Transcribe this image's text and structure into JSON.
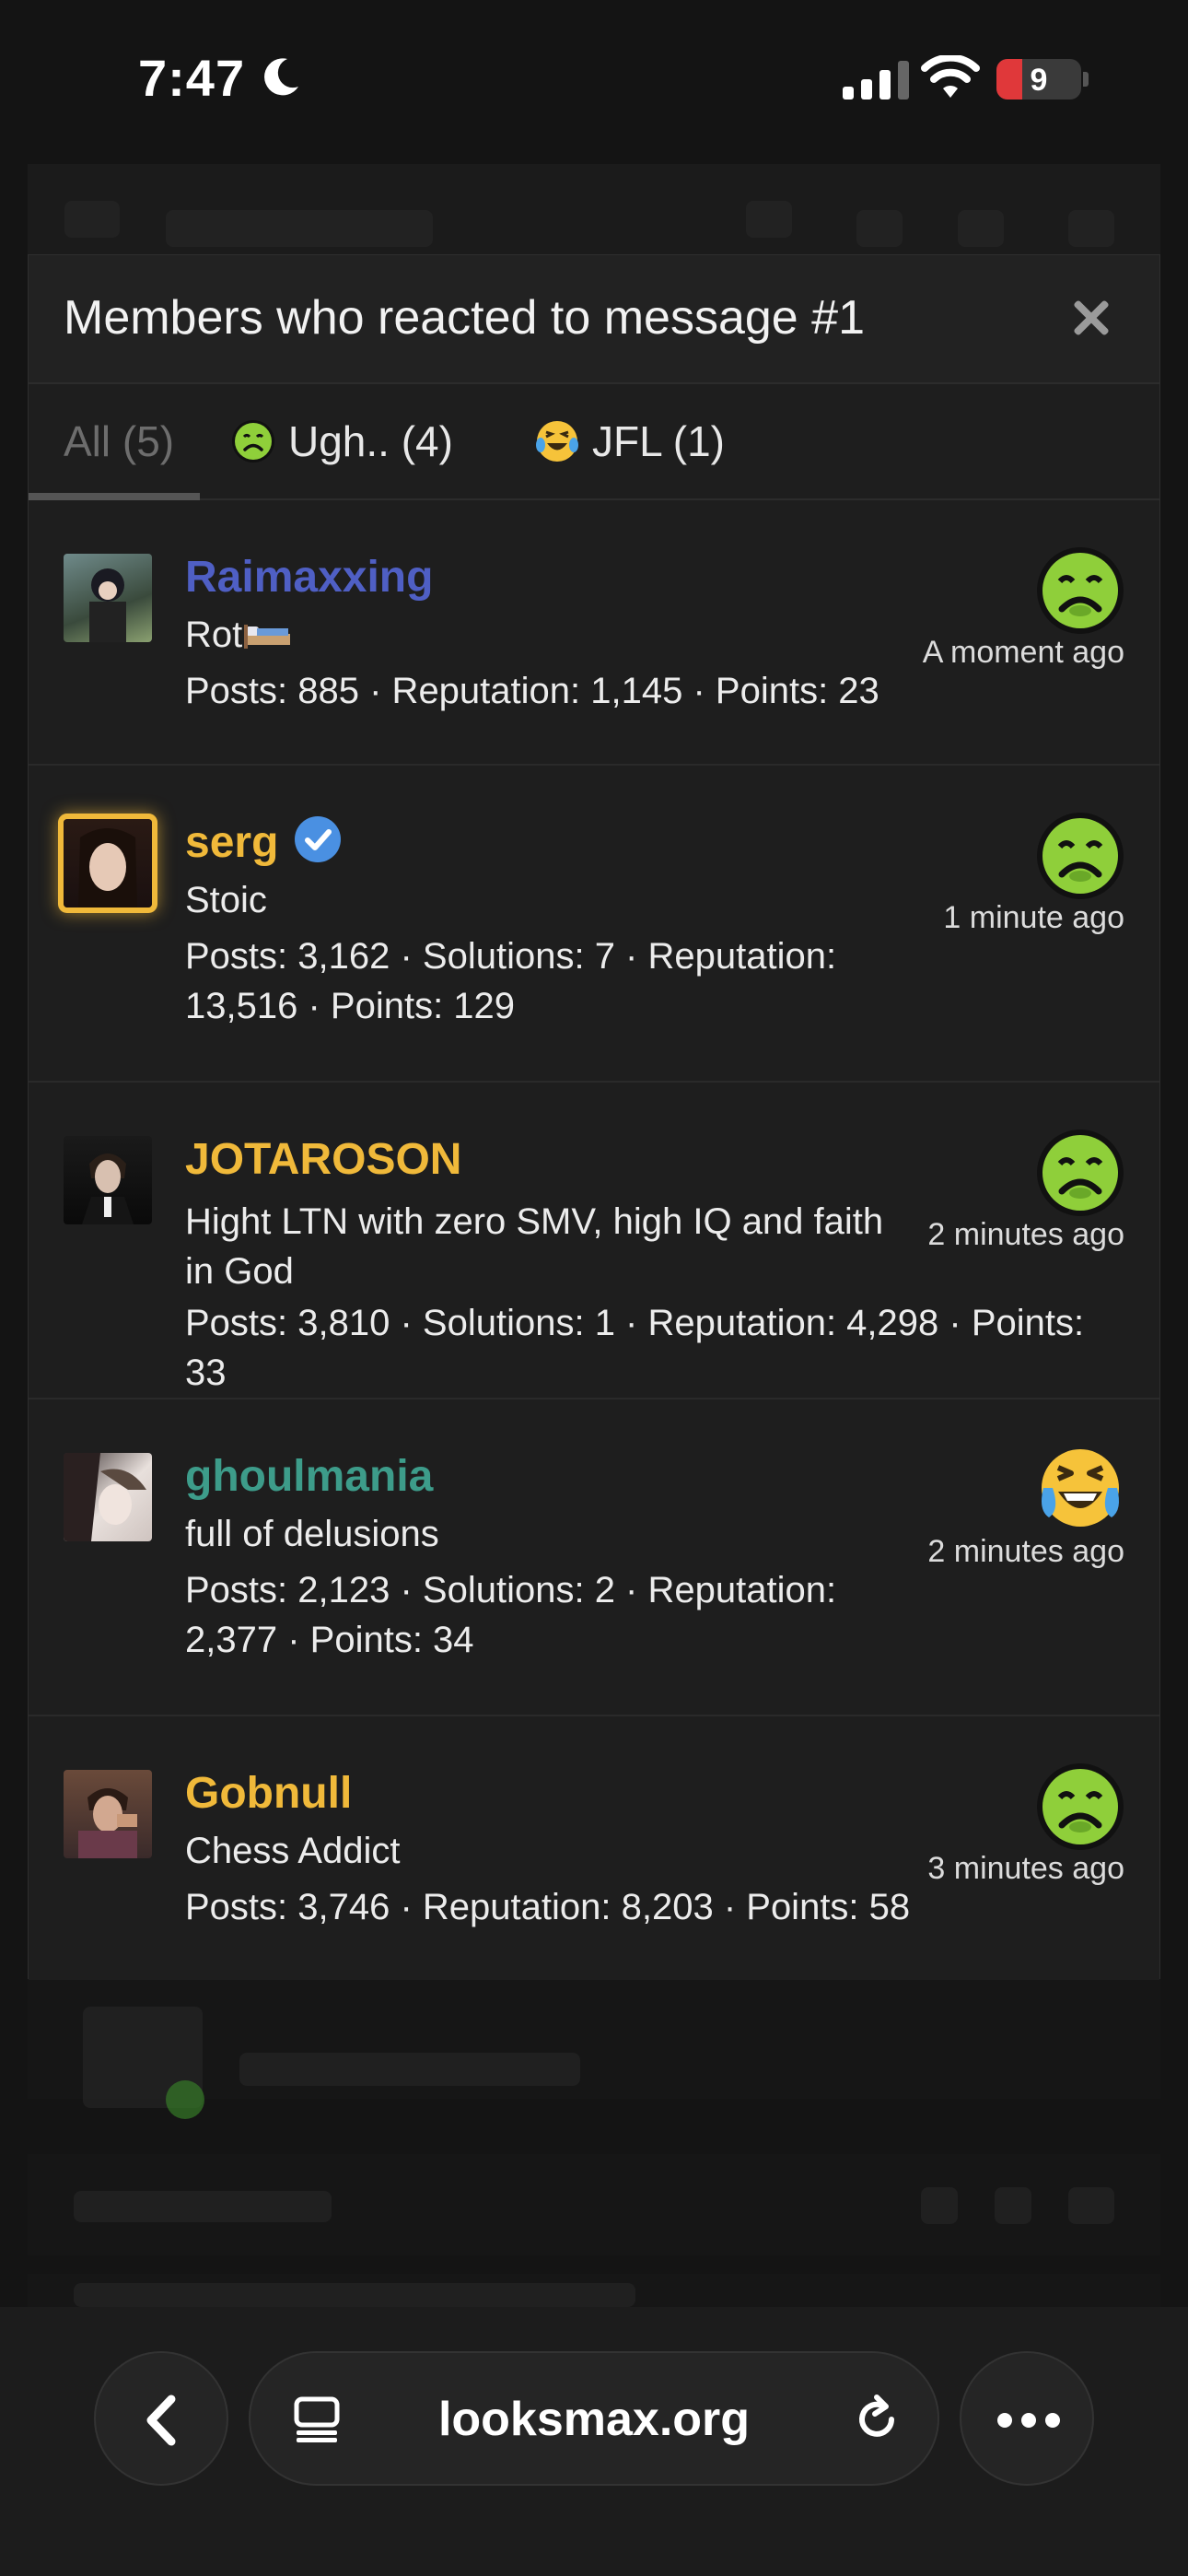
{
  "status_bar": {
    "time": "7:47",
    "battery": "9"
  },
  "modal": {
    "title": "Members who reacted to message #1",
    "tabs": [
      {
        "label": "All (5)",
        "emoji": ""
      },
      {
        "label": "Ugh.. (4)",
        "emoji": "nauseated-face"
      },
      {
        "label": "JFL (1)",
        "emoji": "crying-laughing-face"
      }
    ],
    "members": [
      {
        "name": "Raimaxxing",
        "name_color": "#4f5fc4",
        "title": "Rot",
        "stats": "Posts: 885 · Reputation: 1,145 · Points: 23",
        "time": "A moment ago",
        "reaction": "nauseated-face"
      },
      {
        "name": "serg",
        "name_color": "#f0b93a",
        "title": "Stoic",
        "stats": "Posts: 3,162 · Solutions: 7 · Reputation: 13,516 · Points: 129",
        "time": "1 minute ago",
        "reaction": "nauseated-face",
        "verified": true
      },
      {
        "name": "JOTAROSON",
        "name_color": "#f0b93a",
        "title": "Hight LTN with zero SMV, high IQ and faith in God",
        "stats": "Posts: 3,810 · Solutions: 1 · Reputation: 4,298 · Points: 33",
        "time": "2 minutes ago",
        "reaction": "nauseated-face"
      },
      {
        "name": "ghoulmania",
        "name_color": "#3d9c8a",
        "title": "full of delusions",
        "stats": "Posts: 2,123 · Solutions: 2 · Reputation: 2,377 · Points: 34",
        "time": "2 minutes ago",
        "reaction": "crying-laughing-face"
      },
      {
        "name": "Gobnull",
        "name_color": "#f0b93a",
        "title": "Chess Addict",
        "stats": "Posts: 3,746 · Reputation: 8,203 · Points: 58",
        "time": "3 minutes ago",
        "reaction": "nauseated-face"
      }
    ]
  },
  "browser": {
    "url": "looksmax.org"
  }
}
